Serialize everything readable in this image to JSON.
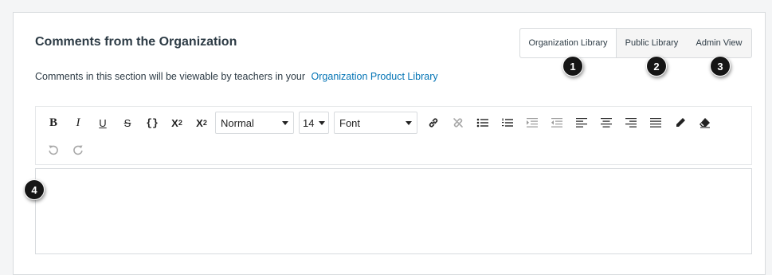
{
  "section": {
    "title": "Comments from the Organization",
    "description": "Comments in this section will be viewable by teachers in your",
    "library_link": "Organization Product Library"
  },
  "view_tabs": [
    {
      "label": "Organization Library",
      "active": true
    },
    {
      "label": "Public Library",
      "active": false
    },
    {
      "label": "Admin View",
      "active": false
    }
  ],
  "callouts": [
    "1",
    "2",
    "3",
    "4"
  ],
  "toolbar": {
    "bold": "B",
    "italic": "I",
    "underline": "U",
    "strikethrough": "S",
    "code": "{}",
    "superscript_base": "X",
    "superscript_mark": "2",
    "subscript_base": "X",
    "subscript_mark": "2",
    "format_value": "Normal",
    "size_value": "14",
    "font_value": "Font"
  },
  "editor": {
    "content": ""
  },
  "colors": {
    "link": "#0374b5",
    "text": "#2d3b45",
    "callout": "#161616",
    "border": "#d8dbde"
  }
}
